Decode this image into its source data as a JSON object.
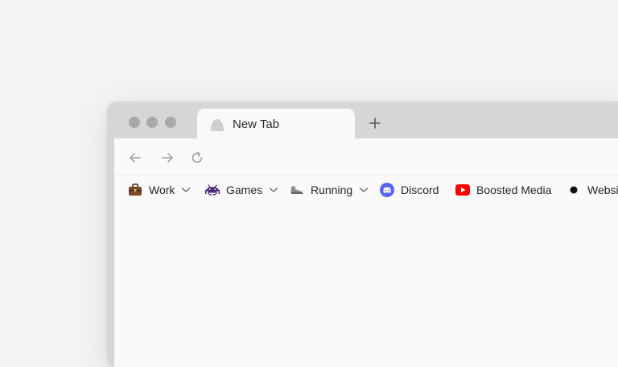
{
  "tab": {
    "title": "New Tab"
  },
  "bookmarks": [
    {
      "label": "Work",
      "icon": "briefcase-icon",
      "has_menu": true
    },
    {
      "label": "Games",
      "icon": "space-invader-icon",
      "has_menu": true
    },
    {
      "label": "Running",
      "icon": "running-shoe-icon",
      "has_menu": true
    },
    {
      "label": "Discord",
      "icon": "discord-icon",
      "has_menu": false
    },
    {
      "label": "Boosted Media",
      "icon": "youtube-icon",
      "has_menu": false
    },
    {
      "label": "Websit",
      "icon": "black-dot-icon",
      "has_menu": false
    }
  ],
  "colors": {
    "discord": "#5865F2",
    "youtube": "#FF0000",
    "chrome_frame": "#d6d6d7",
    "page_background": "#fafafa"
  }
}
